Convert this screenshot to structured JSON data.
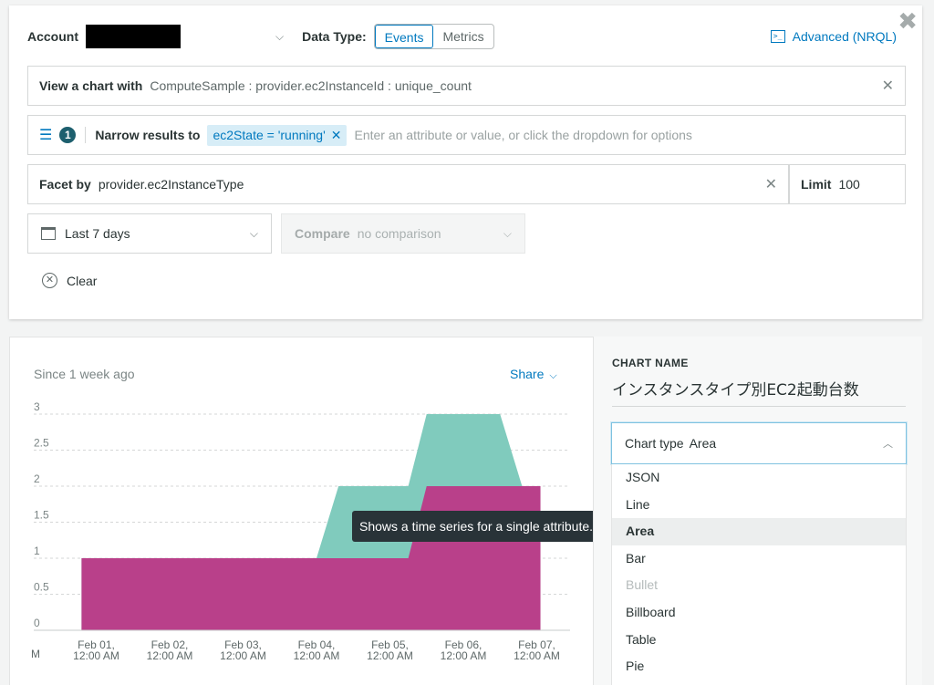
{
  "query": {
    "account_label": "Account",
    "data_type_label": "Data Type:",
    "data_type_options": [
      "Events",
      "Metrics"
    ],
    "advanced_label": "Advanced (NRQL)",
    "view_chart_label": "View a chart with",
    "view_chart_value": "ComputeSample : provider.ec2InstanceId : unique_count",
    "filter_count": "1",
    "narrow_label": "Narrow results to",
    "filter_chip": "ec2State = 'running'",
    "filter_placeholder": "Enter an attribute or value, or click the dropdown for options",
    "facet_label": "Facet by",
    "facet_value": "provider.ec2InstanceType",
    "limit_label": "Limit",
    "limit_value": "100",
    "time_range": "Last 7 days",
    "compare_label": "Compare",
    "compare_value": "no comparison",
    "clear_label": "Clear"
  },
  "chart_panel": {
    "since_label": "Since 1 week ago",
    "share_label": "Share"
  },
  "tooltip": "Shows a time series for a single attribute.",
  "side": {
    "chart_name_label": "CHART NAME",
    "chart_name_value": "インスタンスタイプ別EC2起動台数",
    "chart_type_label": "Chart type",
    "chart_type_value": "Area",
    "menu_items": [
      "JSON",
      "Line",
      "Area",
      "Bar",
      "Bullet",
      "Billboard",
      "Table",
      "Pie"
    ]
  },
  "colors": {
    "accent": "#0079bf",
    "series_a": "#80cbbd",
    "series_b": "#b9408a"
  },
  "chart_data": {
    "type": "area",
    "ylim": [
      0,
      3
    ],
    "y_ticks": [
      "0",
      "0.5",
      "1",
      "1.5",
      "2",
      "2.5",
      "3"
    ],
    "x_ticks": [
      {
        "l1": "M",
        "l2": ""
      },
      {
        "l1": "Feb 01,",
        "l2": "12:00 AM"
      },
      {
        "l1": "Feb 02,",
        "l2": "12:00 AM"
      },
      {
        "l1": "Feb 03,",
        "l2": "12:00 AM"
      },
      {
        "l1": "Feb 04,",
        "l2": "12:00 AM"
      },
      {
        "l1": "Feb 05,",
        "l2": "12:00 AM"
      },
      {
        "l1": "Feb 06,",
        "l2": "12:00 AM"
      },
      {
        "l1": "Feb 07,",
        "l2": "12:00 AM"
      }
    ],
    "series": [
      {
        "color": "#80cbbd",
        "points": [
          [
            0.8,
            0
          ],
          [
            0.8,
            1
          ],
          [
            4.0,
            1
          ],
          [
            4.3,
            2
          ],
          [
            5.25,
            2
          ],
          [
            5.5,
            3
          ],
          [
            6.5,
            3
          ],
          [
            6.8,
            2
          ],
          [
            7.05,
            2
          ],
          [
            7.05,
            0
          ]
        ]
      },
      {
        "color": "#b9408a",
        "points": [
          [
            0.8,
            0
          ],
          [
            0.8,
            1
          ],
          [
            5.25,
            1
          ],
          [
            5.5,
            2
          ],
          [
            7.05,
            2
          ],
          [
            7.05,
            0
          ]
        ]
      }
    ]
  }
}
